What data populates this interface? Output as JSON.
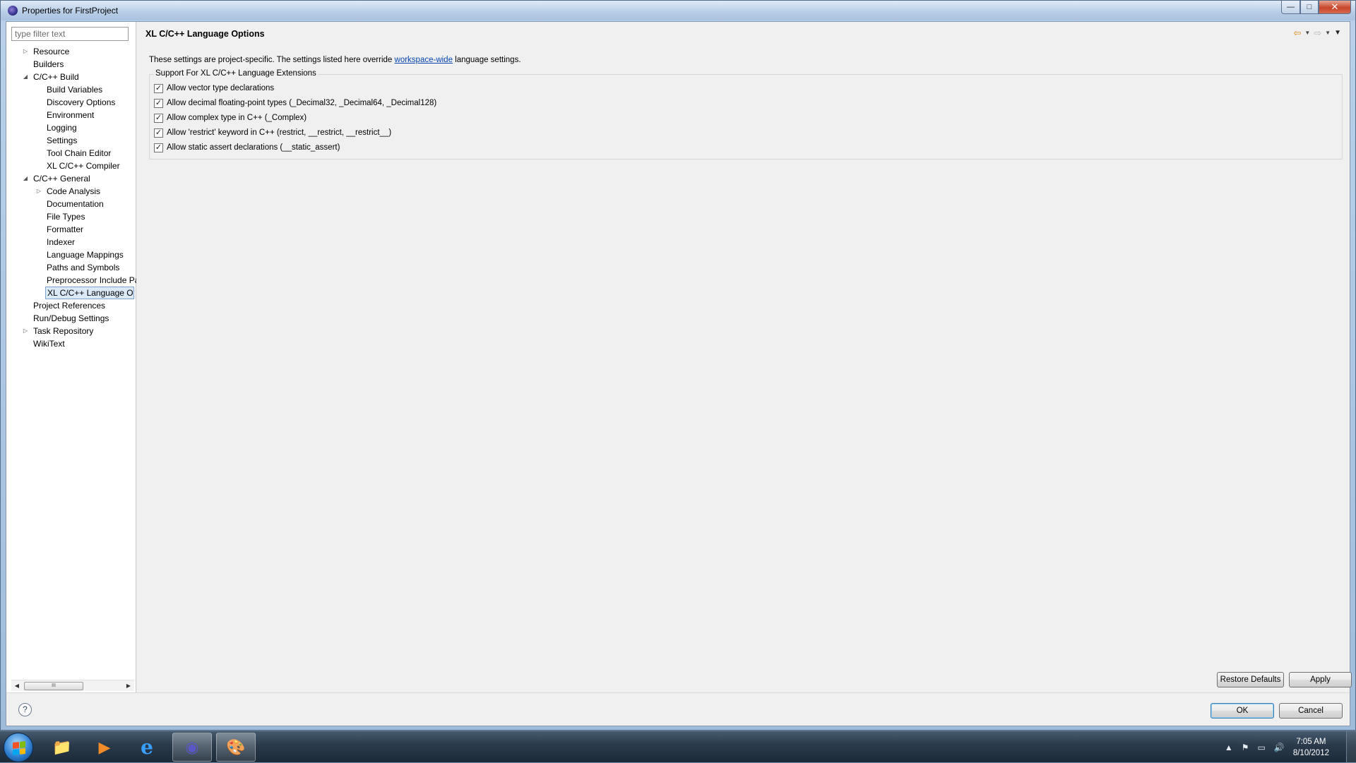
{
  "window": {
    "title": "Properties for FirstProject",
    "controls": {
      "minimize": "—",
      "maximize": "□",
      "close": "✕"
    }
  },
  "filter": {
    "placeholder": "type filter text"
  },
  "tree": {
    "items": [
      {
        "label": "Resource",
        "level": 0,
        "twisty": "collapsed"
      },
      {
        "label": "Builders",
        "level": 0,
        "twisty": "none"
      },
      {
        "label": "C/C++ Build",
        "level": 0,
        "twisty": "expanded"
      },
      {
        "label": "Build Variables",
        "level": 1,
        "twisty": "none"
      },
      {
        "label": "Discovery Options",
        "level": 1,
        "twisty": "none"
      },
      {
        "label": "Environment",
        "level": 1,
        "twisty": "none"
      },
      {
        "label": "Logging",
        "level": 1,
        "twisty": "none"
      },
      {
        "label": "Settings",
        "level": 1,
        "twisty": "none"
      },
      {
        "label": "Tool Chain Editor",
        "level": 1,
        "twisty": "none"
      },
      {
        "label": "XL C/C++ Compiler",
        "level": 1,
        "twisty": "none"
      },
      {
        "label": "C/C++ General",
        "level": 0,
        "twisty": "expanded"
      },
      {
        "label": "Code Analysis",
        "level": 1,
        "twisty": "collapsed"
      },
      {
        "label": "Documentation",
        "level": 1,
        "twisty": "none"
      },
      {
        "label": "File Types",
        "level": 1,
        "twisty": "none"
      },
      {
        "label": "Formatter",
        "level": 1,
        "twisty": "none"
      },
      {
        "label": "Indexer",
        "level": 1,
        "twisty": "none"
      },
      {
        "label": "Language Mappings",
        "level": 1,
        "twisty": "none"
      },
      {
        "label": "Paths and Symbols",
        "level": 1,
        "twisty": "none"
      },
      {
        "label": "Preprocessor Include Pa",
        "level": 1,
        "twisty": "none"
      },
      {
        "label": "XL C/C++ Language Op",
        "level": 1,
        "twisty": "none",
        "selected": true
      },
      {
        "label": "Project References",
        "level": 0,
        "twisty": "none"
      },
      {
        "label": "Run/Debug Settings",
        "level": 0,
        "twisty": "none"
      },
      {
        "label": "Task Repository",
        "level": 0,
        "twisty": "collapsed"
      },
      {
        "label": "WikiText",
        "level": 0,
        "twisty": "none"
      }
    ],
    "scrollbar": {
      "left": "◀",
      "right": "▶",
      "grip": "III"
    }
  },
  "page": {
    "title": "XL C/C++ Language Options",
    "nav": {
      "back": "⇦",
      "forward": "⇨",
      "dropdown": "▼",
      "menu": "▼"
    },
    "description_prefix": "These settings are project-specific. The settings listed here override ",
    "description_link": "workspace-wide",
    "description_suffix": " language settings.",
    "group": {
      "legend": "Support For XL C/C++ Language Extensions",
      "options": [
        {
          "label": "Allow vector type declarations",
          "checked": true
        },
        {
          "label": "Allow decimal floating-point types (_Decimal32, _Decimal64, _Decimal128)",
          "checked": true
        },
        {
          "label": "Allow complex type in C++ (_Complex)",
          "checked": true
        },
        {
          "label": "Allow 'restrict' keyword in C++ (restrict, __restrict, __restrict__)",
          "checked": true
        },
        {
          "label": "Allow static assert declarations (__static_assert)",
          "checked": true
        }
      ]
    },
    "buttons": {
      "restore_defaults": "Restore Defaults",
      "apply": "Apply"
    }
  },
  "dialog_buttons": {
    "help": "?",
    "ok": "OK",
    "cancel": "Cancel"
  },
  "taskbar": {
    "apps": [
      {
        "name": "file-explorer",
        "glyph": "📁"
      },
      {
        "name": "media-player",
        "glyph": "▶"
      },
      {
        "name": "internet-explorer",
        "glyph": "e"
      },
      {
        "name": "eclipse",
        "glyph": "◉",
        "active": true
      },
      {
        "name": "paint",
        "glyph": "🎨",
        "active": true
      }
    ],
    "tray": {
      "up": "▲",
      "flag": "⚑",
      "network": "▭",
      "volume": "🔊"
    },
    "clock": {
      "time": "7:05 AM",
      "date": "8/10/2012"
    }
  },
  "colors": {
    "selection_bg": "#dbe8f6",
    "selection_border": "#7da2ce",
    "link": "#0645ad",
    "dialog_bg": "#f0f0f0"
  }
}
